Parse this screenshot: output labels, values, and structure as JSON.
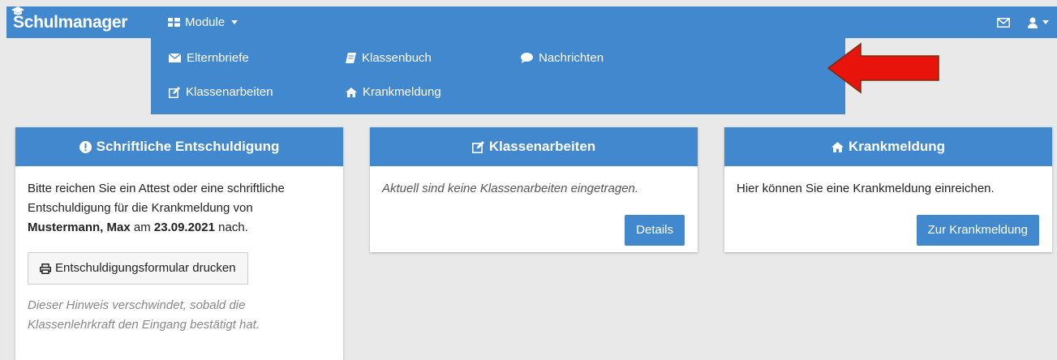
{
  "navbar": {
    "brand": "Schulmanager",
    "modules_label": "Module"
  },
  "dropdown": {
    "elternbriefe": "Elternbriefe",
    "klassenbuch": "Klassenbuch",
    "nachrichten": "Nachrichten",
    "klassenarbeiten": "Klassenarbeiten",
    "krankmeldung": "Krankmeldung"
  },
  "cards": {
    "entschuldigung": {
      "title": "Schriftliche Entschuldigung",
      "text_before": "Bitte reichen Sie ein Attest oder eine schriftliche Entschuldigung für die Krankmeldung von",
      "student": "Mustermann, Max",
      "text_am": "am",
      "date": "23.09.2021",
      "text_after": "nach.",
      "print_button": "Entschuldigungsformular drucken",
      "hint": "Dieser Hinweis verschwindet, sobald die Klassenlehrkraft den Eingang bestätigt hat."
    },
    "klassenarbeiten": {
      "title": "Klassenarbeiten",
      "text": "Aktuell sind keine Klassenarbeiten eingetragen.",
      "button": "Details"
    },
    "krankmeldung": {
      "title": "Krankmeldung",
      "text": "Hier können Sie eine Krankmeldung einreichen.",
      "button": "Zur Krankmeldung"
    }
  },
  "colors": {
    "primary": "#4288ce",
    "background": "#e9e9e9",
    "arrow_red": "#e8140c"
  }
}
